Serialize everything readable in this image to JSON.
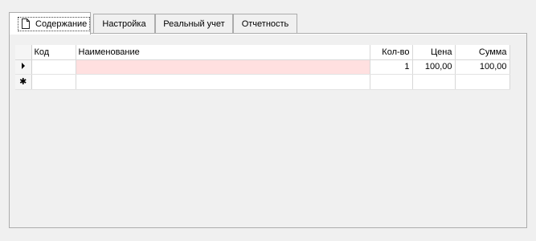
{
  "tabs": [
    {
      "label": "Содержание",
      "active": true
    },
    {
      "label": "Настройка",
      "active": false
    },
    {
      "label": "Реальный учет",
      "active": false
    },
    {
      "label": "Отчетность",
      "active": false
    }
  ],
  "grid": {
    "columns": [
      "Код",
      "Наименование",
      "Кол-во",
      "Цена",
      "Сумма"
    ],
    "rows": [
      {
        "code": "",
        "name": "",
        "qty": "1",
        "price": "100,00",
        "sum": "100,00",
        "current": true
      }
    ],
    "new_row_glyph": "✱"
  },
  "colors": {
    "selected_cell": "#ffe0e0",
    "background": "#f0f0f0",
    "border": "#acacac"
  }
}
